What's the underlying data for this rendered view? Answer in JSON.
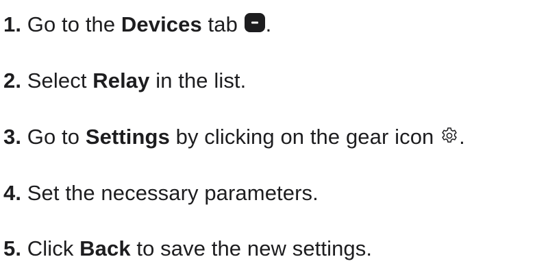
{
  "steps": [
    {
      "number": "1.",
      "parts": [
        "Go to the ",
        "Devices",
        " tab",
        "."
      ],
      "icon": "devices-tab-icon"
    },
    {
      "number": "2.",
      "parts": [
        "Select ",
        "Relay",
        " in the list."
      ]
    },
    {
      "number": "3.",
      "parts": [
        "Go to ",
        "Settings",
        " by clicking on the gear icon ",
        "."
      ],
      "icon": "gear-icon"
    },
    {
      "number": "4.",
      "parts": [
        "Set the necessary parameters."
      ]
    },
    {
      "number": "5.",
      "parts": [
        "Click ",
        "Back",
        " to save the new settings."
      ]
    }
  ],
  "colors": {
    "text": "#1d1d1f",
    "icon_fill": "#1d1d1f",
    "background": "#ffffff"
  }
}
